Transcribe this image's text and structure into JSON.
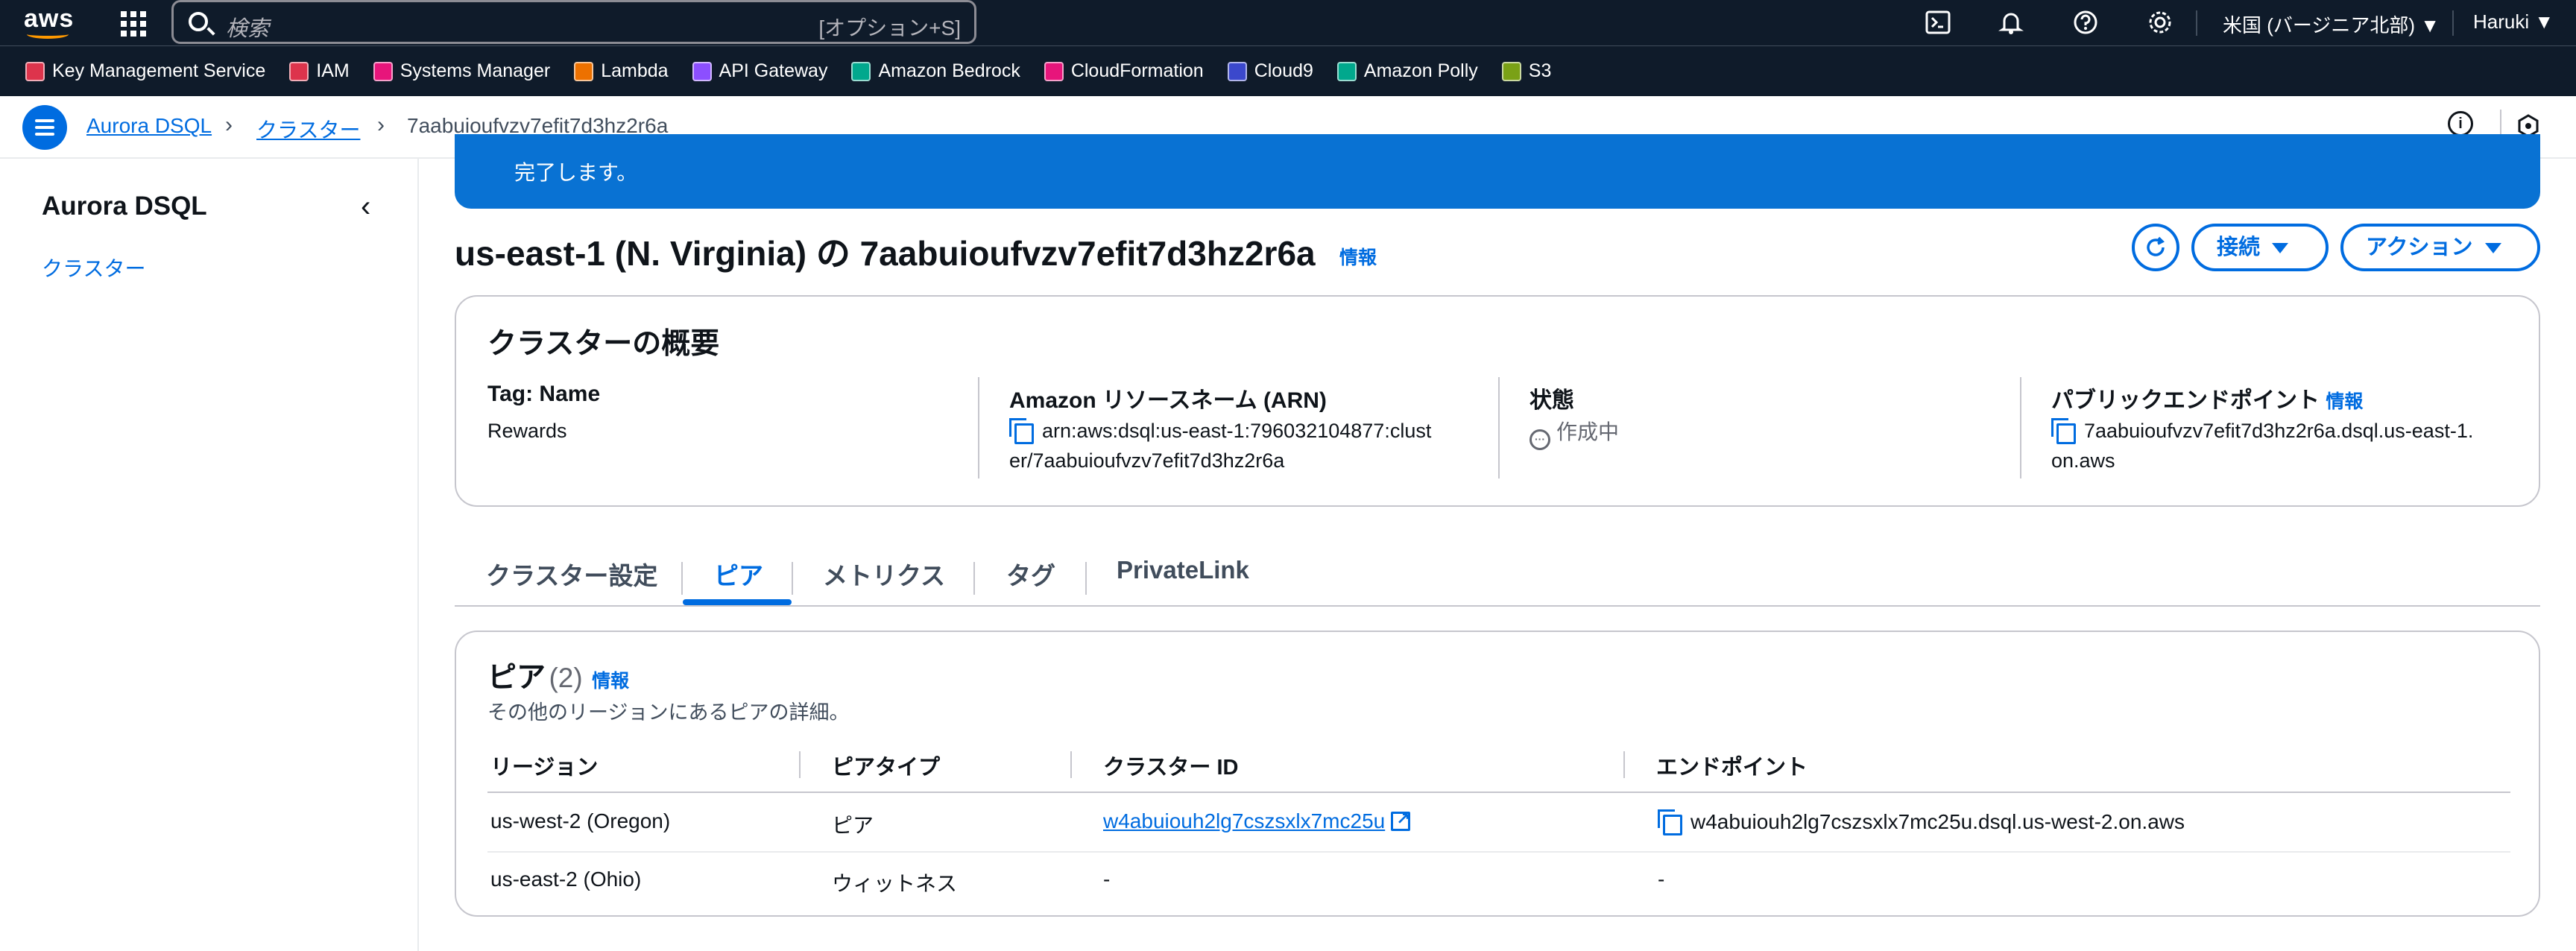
{
  "topnav": {
    "logo_text": "aws",
    "search_placeholder": "検索",
    "search_shortcut": "[オプション+S]",
    "region_label": "米国 (バージニア北部) ▼",
    "user_label": "Haruki ▼"
  },
  "favorites": [
    {
      "label": "Key Management Service",
      "color": "#dd344c"
    },
    {
      "label": "IAM",
      "color": "#dd344c"
    },
    {
      "label": "Systems Manager",
      "color": "#e7157b"
    },
    {
      "label": "Lambda",
      "color": "#ed7100"
    },
    {
      "label": "API Gateway",
      "color": "#8c4fff"
    },
    {
      "label": "Amazon Bedrock",
      "color": "#01a88d"
    },
    {
      "label": "CloudFormation",
      "color": "#e7157b"
    },
    {
      "label": "Cloud9",
      "color": "#3b48cc"
    },
    {
      "label": "Amazon Polly",
      "color": "#01a88d"
    },
    {
      "label": "S3",
      "color": "#7aa116"
    }
  ],
  "breadcrumb": {
    "items": [
      "Aurora DSQL",
      "クラスター",
      "7aabuioufvzv7efit7d3hz2r6a"
    ]
  },
  "sidebar": {
    "title": "Aurora DSQL",
    "items": [
      "クラスター"
    ]
  },
  "flash": {
    "message": "完了します。"
  },
  "page": {
    "title": "us-east-1 (N. Virginia) の 7aabuioufvzv7efit7d3hz2r6a",
    "info": "情報",
    "buttons": {
      "connect": "接続",
      "actions": "アクション"
    }
  },
  "overview": {
    "title": "クラスターの概要",
    "tag_label": "Tag: Name",
    "tag_value": "Rewards",
    "arn_label": "Amazon リソースネーム (ARN)",
    "arn_value_line1": "arn:aws:dsql:us-east-1:796032104877:clust",
    "arn_value_line2": "er/7aabuioufvzv7efit7d3hz2r6a",
    "status_label": "状態",
    "status_value": "作成中",
    "endpoint_label": "パブリックエンドポイント",
    "endpoint_info": "情報",
    "endpoint_value_line1": "7aabuioufvzv7efit7d3hz2r6a.dsql.us-east-1.",
    "endpoint_value_line2": "on.aws"
  },
  "tabs": [
    "クラスター設定",
    "ピア",
    "メトリクス",
    "タグ",
    "PrivateLink"
  ],
  "peers": {
    "title": "ピア",
    "count": "(2)",
    "info": "情報",
    "description": "その他のリージョンにあるピアの詳細。",
    "columns": [
      "リージョン",
      "ピアタイプ",
      "クラスター ID",
      "エンドポイント"
    ],
    "rows": [
      {
        "region": "us-west-2 (Oregon)",
        "type": "ピア",
        "cluster_id": "w4abuiouh2lg7cszsxlx7mc25u",
        "endpoint": "w4abuiouh2lg7cszsxlx7mc25u.dsql.us-west-2.on.aws"
      },
      {
        "region": "us-east-2 (Ohio)",
        "type": "ウィットネス",
        "cluster_id": "-",
        "endpoint": "-"
      }
    ]
  }
}
